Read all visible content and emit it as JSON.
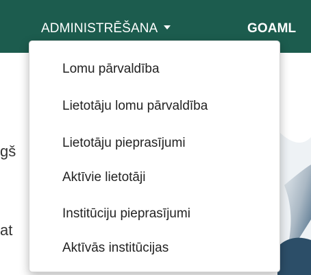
{
  "navbar": {
    "background": "#1c5c4e",
    "items": [
      {
        "label": "ADMINISTRĒŠANA"
      },
      {
        "label": "GOAML"
      }
    ]
  },
  "background_text": {
    "line1": "gš",
    "line2": "at"
  },
  "dropdown": {
    "items": [
      {
        "label": "Lomu pārvaldība"
      },
      {
        "label": "Lietotāju lomu pārvaldība"
      },
      {
        "label": "Lietotāju pieprasījumi"
      },
      {
        "label": "Aktīvie lietotāji"
      },
      {
        "label": "Institūciju pieprasījumi"
      },
      {
        "label": "Aktīvās institūcijas"
      }
    ]
  }
}
